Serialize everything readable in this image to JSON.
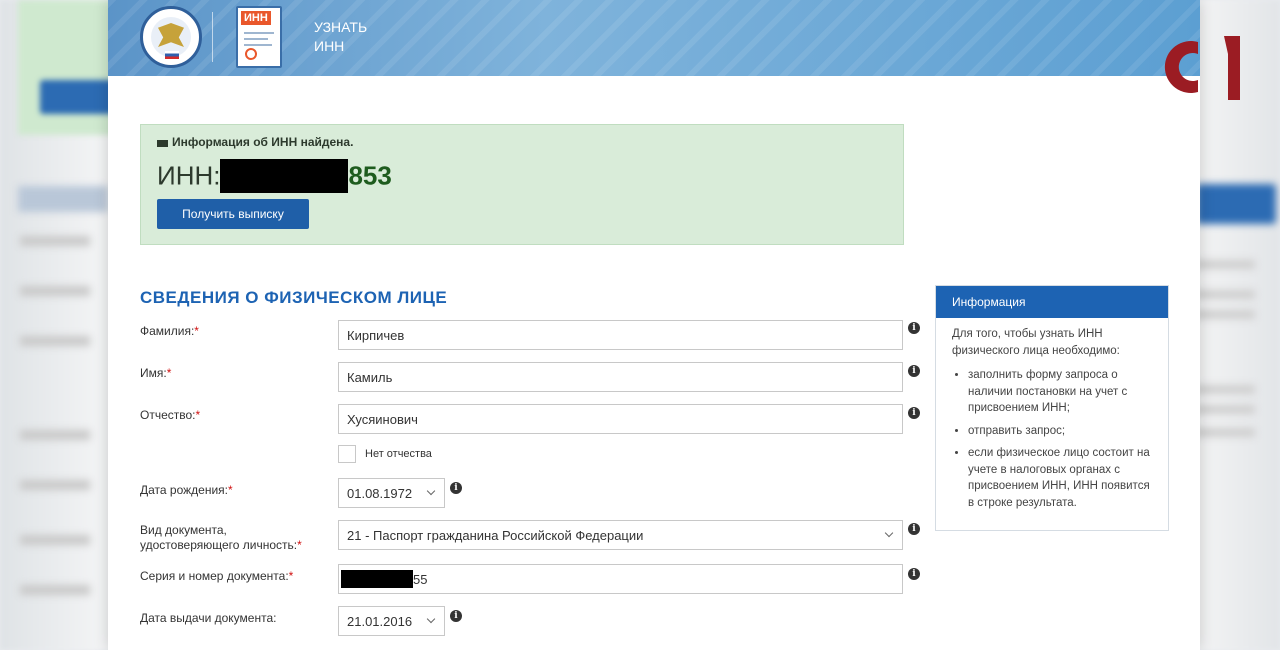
{
  "header": {
    "title_line1": "УЗНАТЬ",
    "title_line2": "ИНН",
    "doc_icon_label": "ИНН"
  },
  "logo": {
    "text": "CI",
    "color": "#9b1c23"
  },
  "result": {
    "message": "Информация об ИНН найдена.",
    "inn_label": "ИНН:",
    "inn_suffix": "853",
    "extract_button": "Получить выписку"
  },
  "form": {
    "section_title": "СВЕДЕНИЯ О ФИЗИЧЕСКОМ ЛИЦЕ",
    "required_mark": "*",
    "surname": {
      "label": "Фамилия:",
      "value": "Кирпичев"
    },
    "name": {
      "label": "Имя:",
      "value": "Камиль"
    },
    "patronymic": {
      "label": "Отчество:",
      "value": "Хусяинович"
    },
    "no_patronymic": {
      "label": "Нет отчества",
      "checked": false
    },
    "birth_date": {
      "label": "Дата рождения:",
      "value": "01.08.1972"
    },
    "doc_type": {
      "label_line1": "Вид документа,",
      "label_line2": "удостоверяющего личность:",
      "value": "21 - Паспорт гражданина Российской Федерации"
    },
    "doc_number": {
      "label": "Серия и номер документа:",
      "value_suffix": "55"
    },
    "issue_date": {
      "label": "Дата выдачи документа:",
      "value": "21.01.2016"
    },
    "info_glyph": "i"
  },
  "info_panel": {
    "title": "Информация",
    "intro": "Для того, чтобы узнать ИНН физического лица необходимо:",
    "items": [
      "заполнить форму запроса о наличии постановки на учет с присвоением ИНН;",
      "отправить запрос;",
      "если физическое лицо состоит на учете в налоговых органах с присвоением ИНН, ИНН появится в строке результата."
    ]
  },
  "colors": {
    "accent_blue": "#1d63b3",
    "success_bg": "#d9ecd9",
    "required_red": "#d01010"
  }
}
